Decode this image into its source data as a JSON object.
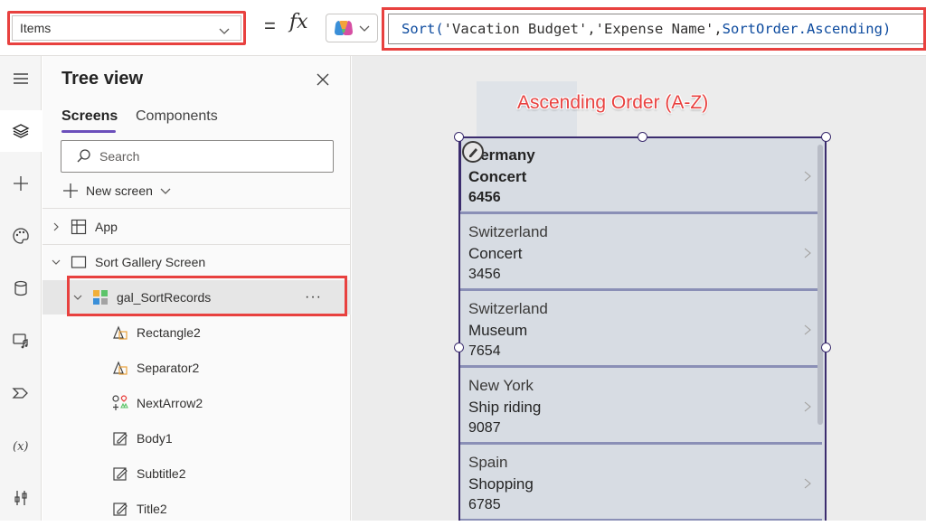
{
  "formula_bar": {
    "property": "Items",
    "equals": "=",
    "fx": "fx",
    "formula_parts": {
      "fn": "Sort(",
      "arg1": "'Vacation Budget'",
      "comma1": ",",
      "arg2": "'Expense Name'",
      "comma2": ",",
      "arg3": "SortOrder.Ascending",
      "close": ")"
    }
  },
  "rail": {
    "icons": [
      "menu-icon",
      "layers-icon",
      "add-icon",
      "palette-icon",
      "database-icon",
      "media-icon",
      "power-automate-icon",
      "variables-icon",
      "tools-icon"
    ]
  },
  "tree_view": {
    "title": "Tree view",
    "tabs": [
      "Screens",
      "Components"
    ],
    "search_placeholder": "Search",
    "new_screen_label": "New screen",
    "nodes": {
      "app": "App",
      "screen": "Sort Gallery Screen",
      "gallery": "gal_SortRecords",
      "more": "···",
      "children": [
        "Rectangle2",
        "Separator2",
        "NextArrow2",
        "Body1",
        "Subtitle2",
        "Title2"
      ]
    }
  },
  "canvas": {
    "caption": "Ascending Order (A-Z)",
    "gallery_items": [
      {
        "title": "Germany",
        "subtitle": "Concert",
        "body": "6456"
      },
      {
        "title": "Switzerland",
        "subtitle": "Concert",
        "body": "3456"
      },
      {
        "title": "Switzerland",
        "subtitle": "Museum",
        "body": "7654"
      },
      {
        "title": "New York",
        "subtitle": "Ship riding",
        "body": "9087"
      },
      {
        "title": "Spain",
        "subtitle": "Shopping",
        "body": "6785"
      }
    ]
  },
  "colors": {
    "annotation_red": "#e8413f",
    "selection_purple": "#3b2c6e",
    "tab_accent": "#6b4fbb"
  }
}
